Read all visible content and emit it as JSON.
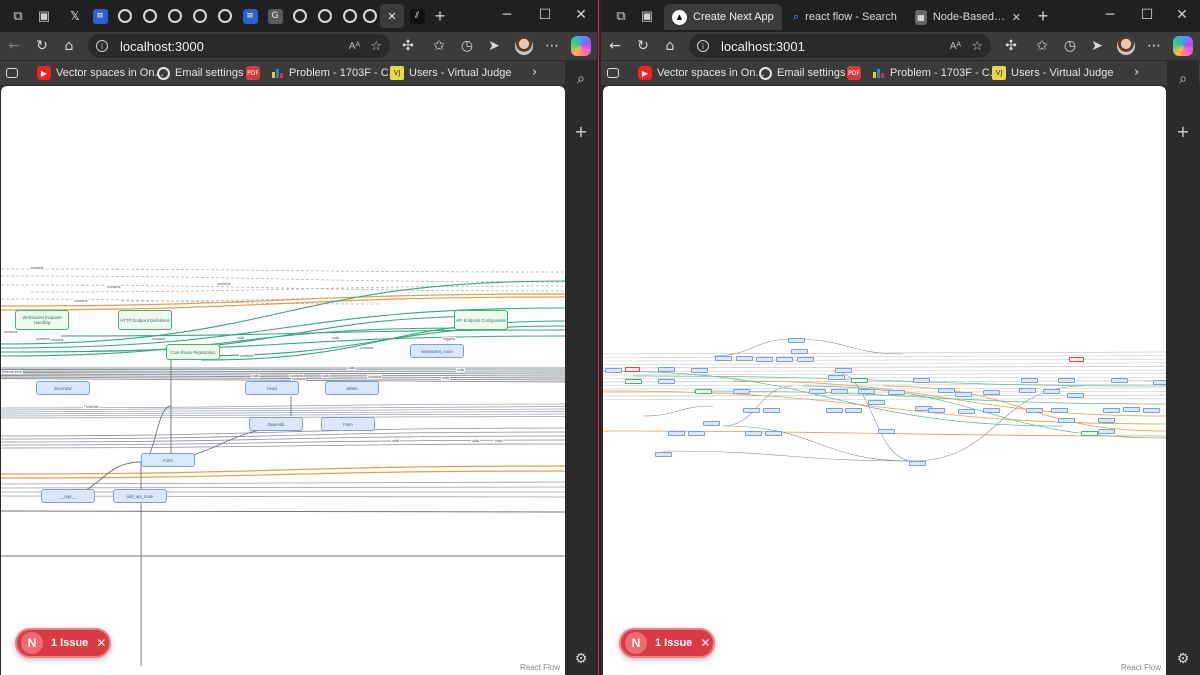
{
  "left_window": {
    "tabs_collapsed": [
      "X",
      "Docs",
      "GitHub",
      "GitHub",
      "GitHub",
      "GitHub",
      "GitHub",
      "Docs",
      "G",
      "GitHub",
      "GitHub",
      "GitHub",
      "GitHub",
      "Active",
      "Next"
    ],
    "address": "localhost:3000",
    "read_aloud": "Aᴬ",
    "bookmarks": [
      {
        "label": "Vector spaces in On...",
        "icon": "youtube-icon"
      },
      {
        "label": "Email settings",
        "icon": "github-icon"
      },
      {
        "label": "Problem - 1703F - C...",
        "icon": "codeforces-icon"
      },
      {
        "label": "Users - Virtual Judge",
        "icon": "vjudge-icon"
      }
    ],
    "graph": {
      "nodes": [
        {
          "id": "ws",
          "label": "WebSocket Endpoint Handling",
          "kind": "green"
        },
        {
          "id": "http",
          "label": "HTTP Endpoint Definitions",
          "kind": "green"
        },
        {
          "id": "api",
          "label": "API Endpoint Configuration",
          "kind": "green"
        },
        {
          "id": "core",
          "label": "Core Route Registration",
          "kind": "green"
        },
        {
          "id": "wsroute",
          "label": "websocket_route",
          "kind": "blue"
        },
        {
          "id": "decorator",
          "label": "decorator",
          "kind": "blue"
        },
        {
          "id": "head",
          "label": "head",
          "kind": "blue"
        },
        {
          "id": "delete",
          "label": "delete",
          "kind": "blue"
        },
        {
          "id": "depends",
          "label": "Depends",
          "kind": "blue"
        },
        {
          "id": "form1",
          "label": "Form",
          "kind": "blue"
        },
        {
          "id": "form2",
          "label": "Form",
          "kind": "blue"
        },
        {
          "id": "repr",
          "label": "__repr__",
          "kind": "blue"
        },
        {
          "id": "addapi",
          "label": "add_api_route",
          "kind": "blue"
        }
      ],
      "edge_labels": [
        "contains",
        "contains",
        "contains",
        "contains",
        "contains",
        "contains",
        "contains",
        "calls",
        "calls",
        "contains",
        "contains",
        "triggers",
        "contains",
        "calls",
        "calls",
        "extends",
        "contains",
        "inherits from",
        "calls",
        "contains",
        "contains",
        "contains",
        "extends",
        "calls",
        "calls",
        "calls",
        "calls",
        "calls"
      ]
    },
    "attribution": "React Flow",
    "issue": {
      "badge": "N",
      "text": "1 Issue",
      "close": "✕"
    }
  },
  "right_window": {
    "tabs": [
      {
        "title": "Create Next App",
        "icon": "nextjs-icon",
        "active": true
      },
      {
        "title": "react flow - Search",
        "icon": "search-icon",
        "active": false
      },
      {
        "title": "Node-Based UIs in",
        "icon": "xyflow-icon",
        "active": false
      }
    ],
    "address": "localhost:3001",
    "read_aloud": "Aᴬ",
    "bookmarks": [
      {
        "label": "Vector spaces in On...",
        "icon": "youtube-icon"
      },
      {
        "label": "Email settings",
        "icon": "github-icon"
      },
      {
        "label": "Problem - 1703F - C...",
        "icon": "codeforces-icon"
      },
      {
        "label": "Users - Virtual Judge",
        "icon": "vjudge-icon"
      }
    ],
    "attribution": "React Flow",
    "issue": {
      "badge": "N",
      "text": "1 Issue",
      "close": "✕"
    }
  },
  "colors": {
    "chrome_dark": "#202020",
    "toolbar": "#3b3b3b",
    "node_blue_fill": "#dbe8fb",
    "node_blue_border": "#7b9fd6",
    "node_green_border": "#46b374",
    "edge_green": "#3aa67a",
    "edge_orange": "#e0a050",
    "edge_gray": "#8a8f98",
    "issue_red": "#d93a44"
  }
}
